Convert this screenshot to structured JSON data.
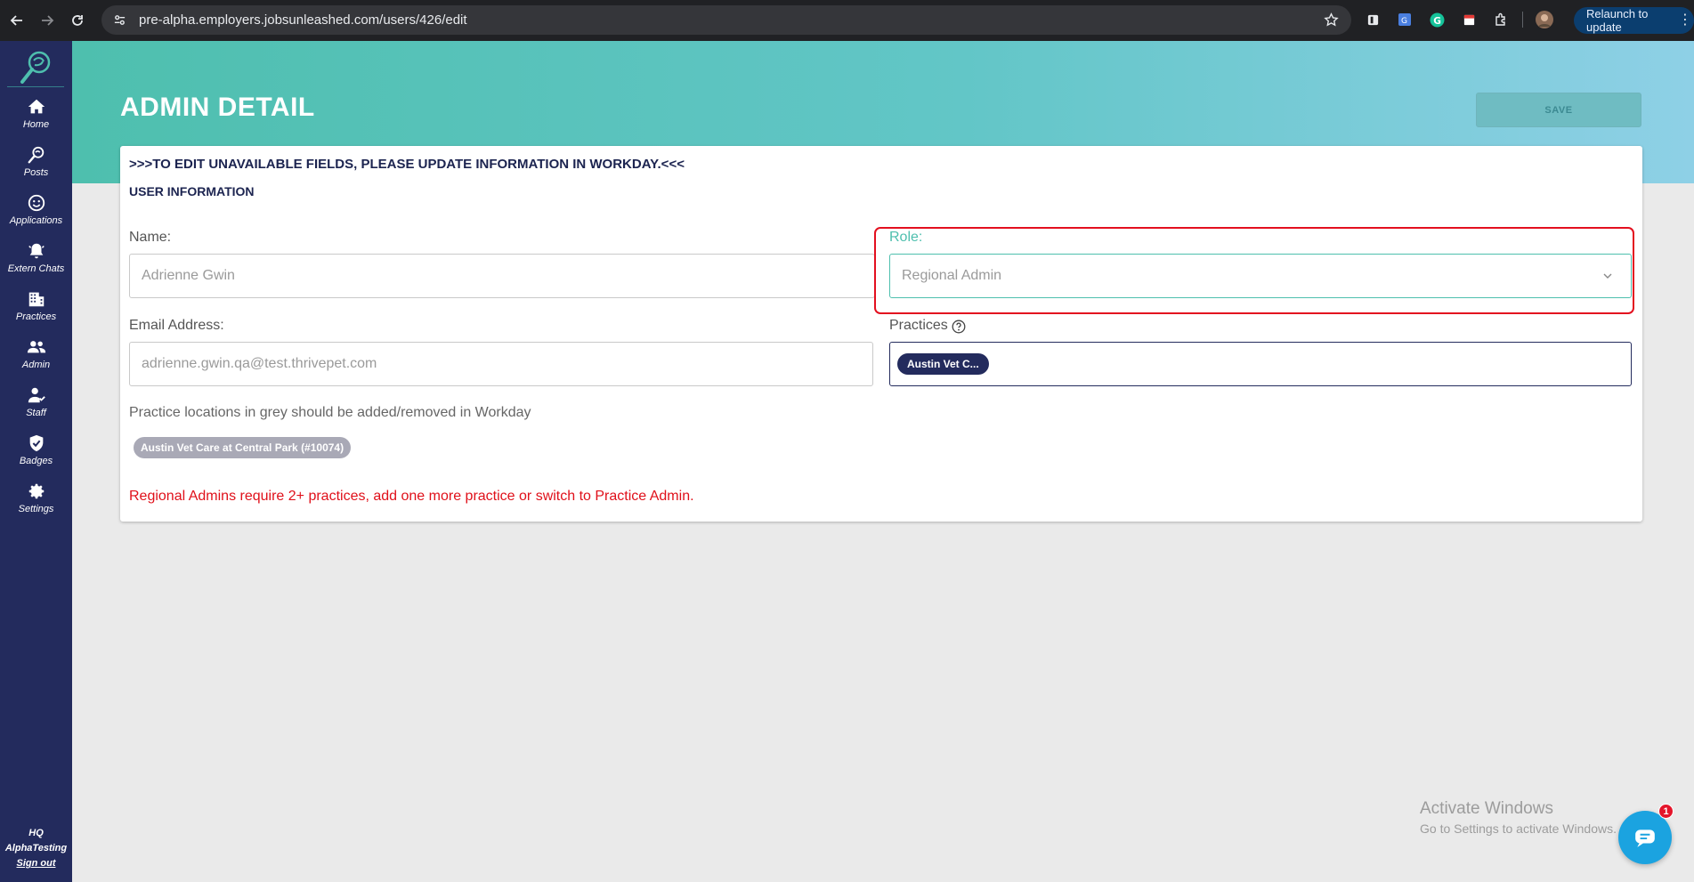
{
  "browser": {
    "url": "pre-alpha.employers.jobsunleashed.com/users/426/edit",
    "relaunch_label": "Relaunch to update"
  },
  "sidebar": {
    "items": [
      {
        "label": "Home",
        "icon": "home-icon"
      },
      {
        "label": "Posts",
        "icon": "posts-icon"
      },
      {
        "label": "Applications",
        "icon": "smiley-icon"
      },
      {
        "label": "Extern Chats",
        "icon": "bell-icon"
      },
      {
        "label": "Practices",
        "icon": "building-icon"
      },
      {
        "label": "Admin",
        "icon": "people-icon"
      },
      {
        "label": "Staff",
        "icon": "staff-icon"
      },
      {
        "label": "Badges",
        "icon": "shield-check-icon"
      },
      {
        "label": "Settings",
        "icon": "gear-icon"
      }
    ],
    "org_line1": "HQ",
    "org_line2": "AlphaTesting",
    "signout": "Sign out"
  },
  "header": {
    "title": "ADMIN DETAIL",
    "save_label": "SAVE"
  },
  "card": {
    "notice": ">>>TO EDIT UNAVAILABLE FIELDS, PLEASE UPDATE INFORMATION IN WORKDAY.<<<",
    "section_title": "USER INFORMATION",
    "name_label": "Name:",
    "name_value": "Adrienne Gwin",
    "role_label": "Role:",
    "role_value": "Regional Admin",
    "email_label": "Email Address:",
    "email_value": "adrienne.gwin.qa@test.thrivepet.com",
    "practices_label": "Practices",
    "practice_chip": "Austin Vet C...",
    "hint": "Practice locations in grey should be added/removed in Workday",
    "grey_chip": "Austin Vet Care at Central Park (#10074)",
    "error": "Regional Admins require 2+ practices, add one more practice or switch to Practice Admin."
  },
  "watermark": {
    "line1": "Activate Windows",
    "line2": "Go to Settings to activate Windows."
  },
  "chat": {
    "badge_count": "1"
  },
  "colors": {
    "sidebar": "#232b5d",
    "accent": "#4ebfae",
    "error": "#e0101a"
  }
}
